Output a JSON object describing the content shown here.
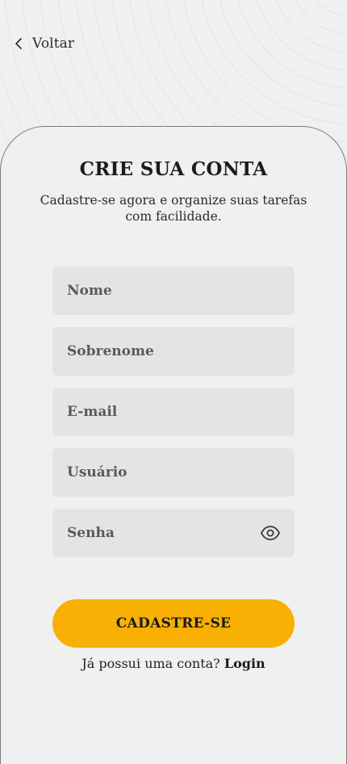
{
  "nav": {
    "back_label": "Voltar",
    "back_icon": "chevron-left-icon"
  },
  "header": {
    "title": "CRIE SUA CONTA",
    "subtitle": "Cadastre-se agora e organize suas tarefas com facilidade."
  },
  "form": {
    "fields": [
      {
        "placeholder": "Nome",
        "value": ""
      },
      {
        "placeholder": "Sobrenome",
        "value": ""
      },
      {
        "placeholder": "E-mail",
        "value": ""
      },
      {
        "placeholder": "Usuário",
        "value": ""
      },
      {
        "placeholder": "Senha",
        "value": "",
        "icon": "eye-icon"
      }
    ],
    "submit_label": "CADASTRE-SE"
  },
  "footer": {
    "prompt": "Já possui uma conta?",
    "login_label": "Login"
  },
  "colors": {
    "background": "#f0f0f0",
    "field_background": "#e4e4e4",
    "accent": "#f8b005",
    "text": "#1f1f1f"
  }
}
